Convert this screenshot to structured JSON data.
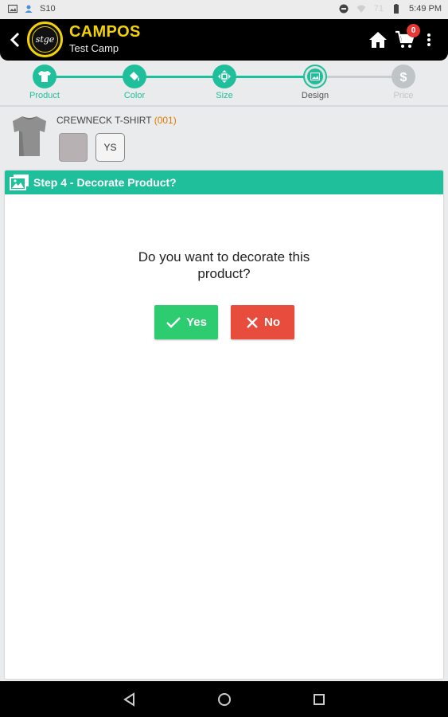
{
  "status_bar": {
    "carrier": "S10",
    "signal": "71",
    "time": "5:49 PM"
  },
  "app_bar": {
    "logo_text": "stge",
    "title": "CAMPOS",
    "subtitle": "Test Camp",
    "cart_count": "0"
  },
  "stepper": {
    "steps": [
      {
        "label": "Product",
        "state": "done",
        "icon": "tshirt-icon"
      },
      {
        "label": "Color",
        "state": "done",
        "icon": "paint-bucket-icon"
      },
      {
        "label": "Size",
        "state": "done",
        "icon": "resize-arrows-icon"
      },
      {
        "label": "Design",
        "state": "current",
        "icon": "image-icon"
      },
      {
        "label": "Price",
        "state": "pending",
        "icon": "dollar-icon"
      }
    ],
    "colors": {
      "done": "#1fbf9b",
      "current": "#b9bfc2",
      "pending": "#bfc4c6"
    }
  },
  "product": {
    "name": "CREWNECK T-SHIRT",
    "code": "(001)",
    "swatch_color": "#b7b1b4",
    "size": "YS"
  },
  "panel": {
    "title": "Step 4 - Decorate Product?",
    "question_line1": "Do you want to decorate this",
    "question_line2": "product?",
    "yes_label": "Yes",
    "no_label": "No"
  },
  "colors": {
    "accent": "#1fbf9b",
    "brand_yellow": "#f1d10a",
    "yes": "#2ecc71",
    "no": "#e74c3c"
  }
}
